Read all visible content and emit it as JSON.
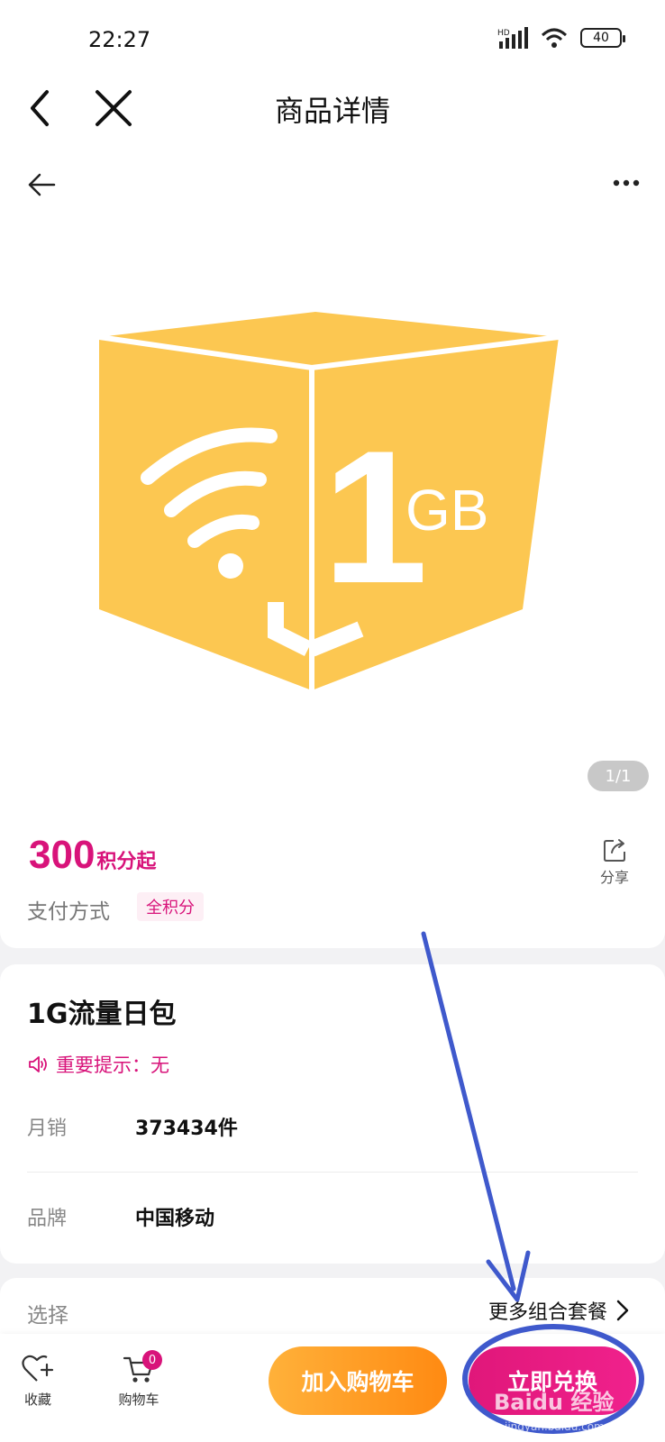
{
  "status_bar": {
    "time": "22:27",
    "network": "HD",
    "battery": "40"
  },
  "nav": {
    "title": "商品详情"
  },
  "gallery": {
    "pager": "1/1",
    "image_label_num": "1",
    "image_label_unit": "GB"
  },
  "price": {
    "value": "300",
    "unit": "积分起",
    "share_label": "分享"
  },
  "payment": {
    "label": "支付方式",
    "tag": "全积分"
  },
  "product": {
    "title": "1G流量日包",
    "notice": "重要提示：无",
    "rows": [
      {
        "key": "月销",
        "value": "373434件"
      },
      {
        "key": "品牌",
        "value": "中国移动"
      }
    ]
  },
  "selection": {
    "label": "选择",
    "more": "更多组合套餐"
  },
  "bottom_bar": {
    "favorite": "收藏",
    "cart": "购物车",
    "cart_count": "0",
    "add_to_cart": "加入购物车",
    "redeem": "立即兑换"
  },
  "watermark": {
    "text": "Baidu 经验",
    "sub": "jingyan.baidu.com"
  },
  "colors": {
    "accent": "#d8137a",
    "orange": "#ff9a1f",
    "box": "#fcc751",
    "annotation": "#3f59cc"
  }
}
